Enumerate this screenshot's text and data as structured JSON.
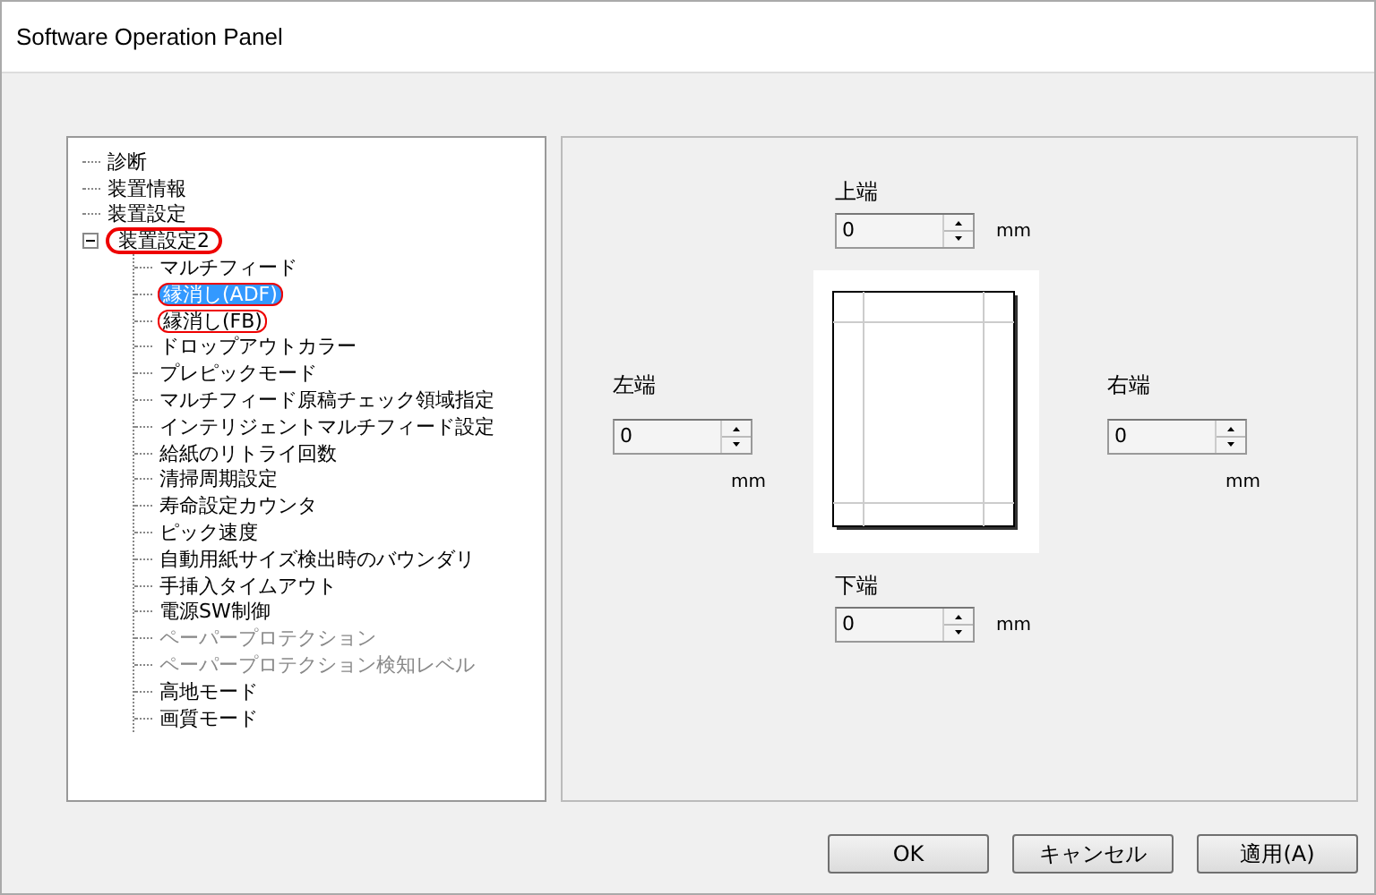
{
  "window": {
    "title": "Software Operation Panel"
  },
  "tree": [
    {
      "label": "診断",
      "selected": false,
      "disabled": false
    },
    {
      "label": "装置情報",
      "selected": false,
      "disabled": false
    },
    {
      "label": "装置設定",
      "selected": false,
      "disabled": false
    },
    {
      "label": "装置設定2",
      "selected": false,
      "disabled": false,
      "expanded": true,
      "highlighted": true,
      "children": [
        {
          "label": "マルチフィード",
          "selected": false,
          "disabled": false
        },
        {
          "label": "縁消し(ADF)",
          "selected": true,
          "disabled": false,
          "highlighted": true
        },
        {
          "label": "縁消し(FB)",
          "selected": false,
          "disabled": false,
          "highlighted": true
        },
        {
          "label": "ドロップアウトカラー",
          "selected": false,
          "disabled": false
        },
        {
          "label": "プレピックモード",
          "selected": false,
          "disabled": false
        },
        {
          "label": "マルチフィード原稿チェック領域指定",
          "selected": false,
          "disabled": false
        },
        {
          "label": "インテリジェントマルチフィード設定",
          "selected": false,
          "disabled": false
        },
        {
          "label": "給紙のリトライ回数",
          "selected": false,
          "disabled": false
        },
        {
          "label": "清掃周期設定",
          "selected": false,
          "disabled": false
        },
        {
          "label": "寿命設定カウンタ",
          "selected": false,
          "disabled": false
        },
        {
          "label": "ピック速度",
          "selected": false,
          "disabled": false
        },
        {
          "label": "自動用紙サイズ検出時のバウンダリ",
          "selected": false,
          "disabled": false
        },
        {
          "label": "手挿入タイムアウト",
          "selected": false,
          "disabled": false
        },
        {
          "label": "電源SW制御",
          "selected": false,
          "disabled": false
        },
        {
          "label": "ペーパープロテクション",
          "selected": false,
          "disabled": true
        },
        {
          "label": "ペーパープロテクション検知レベル",
          "selected": false,
          "disabled": true
        },
        {
          "label": "高地モード",
          "selected": false,
          "disabled": false
        },
        {
          "label": "画質モード",
          "selected": false,
          "disabled": false
        }
      ]
    }
  ],
  "margins": {
    "top": {
      "label": "上端",
      "value": "0",
      "unit": "mm"
    },
    "left": {
      "label": "左端",
      "value": "0",
      "unit": "mm"
    },
    "right": {
      "label": "右端",
      "value": "0",
      "unit": "mm"
    },
    "bottom": {
      "label": "下端",
      "value": "0",
      "unit": "mm"
    }
  },
  "buttons": [
    "OK",
    "キャンセル",
    "適用(A)"
  ]
}
